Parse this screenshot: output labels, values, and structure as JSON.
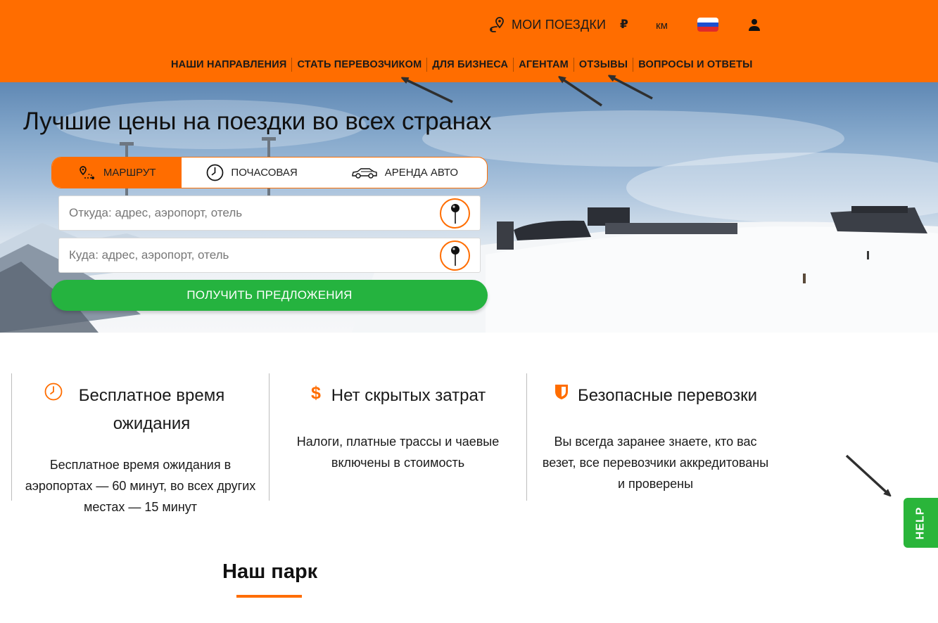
{
  "header": {
    "my_trips": "МОИ ПОЕЗДКИ",
    "currency": "₽",
    "units": "км",
    "nav": [
      {
        "label": "НАШИ НАПРАВЛЕНИЯ"
      },
      {
        "label": "СТАТЬ ПЕРЕВОЗЧИКОМ"
      },
      {
        "label": "ДЛЯ БИЗНЕСА"
      },
      {
        "label": "АГЕНТАМ"
      },
      {
        "label": "ОТЗЫВЫ"
      },
      {
        "label": "ВОПРОСЫ И ОТВЕТЫ"
      }
    ]
  },
  "hero": {
    "title": "Лучшие цены на поездки во всех странах"
  },
  "booking": {
    "tabs": [
      {
        "label": "МАРШРУТ",
        "icon": "route-icon",
        "active": true
      },
      {
        "label": "ПОЧАСОВАЯ",
        "icon": "clock-icon",
        "active": false
      },
      {
        "label": "АРЕНДА АВТО",
        "icon": "car-icon",
        "active": false
      }
    ],
    "from_placeholder": "Откуда: адрес, аэропорт, отель",
    "to_placeholder": "Куда: адрес, аэропорт, отель",
    "submit_label": "ПОЛУЧИТЬ ПРЕДЛОЖЕНИЯ"
  },
  "features": [
    {
      "icon": "clock-icon",
      "title": "Бесплатное время ожидания",
      "text": "Бесплатное время ожидания в аэропортах — 60 минут, во всех других местах — 15 минут"
    },
    {
      "icon": "dollar-icon",
      "title": "Нет скрытых затрат",
      "text": "Налоги, платные трассы и чаевые включены в стоимость"
    },
    {
      "icon": "shield-icon",
      "title": "Безопасные перевозки",
      "text": "Вы всегда заранее знаете, кто вас везет, все перевозчики аккредитованы и проверены"
    }
  ],
  "park": {
    "title": "Наш парк"
  },
  "help": {
    "label": "HELP"
  },
  "colors": {
    "brand_orange": "#ff6d00",
    "action_green": "#25b33f",
    "help_green": "#2ab53a"
  }
}
